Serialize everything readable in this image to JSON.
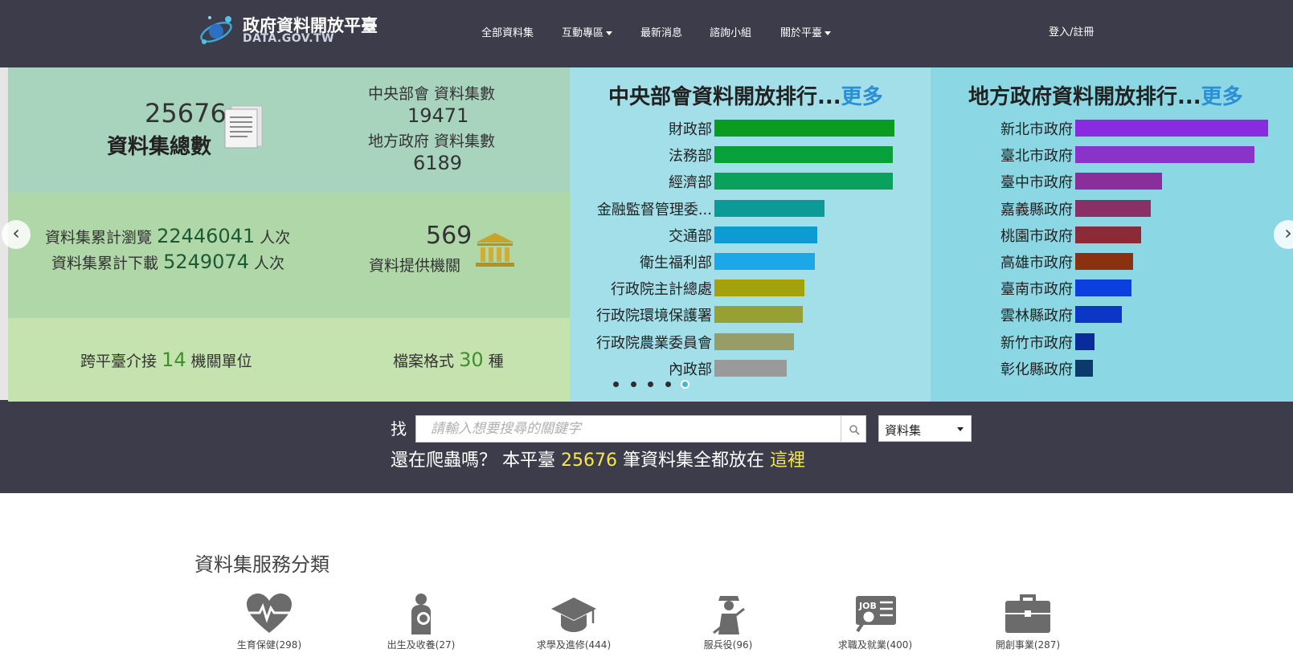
{
  "brand": {
    "title": "政府資料開放平臺",
    "subtitle": "DATA.GOV.TW"
  },
  "nav": {
    "items": [
      "全部資料集",
      "互動專區",
      "最新消息",
      "諮詢小組",
      "關於平臺"
    ]
  },
  "header": {
    "login_label": "登入/註冊"
  },
  "stats": {
    "total_datasets": "25676",
    "total_label": "資料集總數",
    "central_label": "中央部會 資料集數",
    "central_value": "19471",
    "local_label": "地方政府 資料集數",
    "local_value": "6189",
    "views_prefix": "資料集累計瀏覽",
    "views_value": "22446041",
    "views_suffix": "人次",
    "downloads_prefix": "資料集累計下載",
    "downloads_value": "5249074",
    "downloads_suffix": "人次",
    "agencies_value": "569",
    "agencies_label": "資料提供機關",
    "cross_prefix": "跨平臺介接",
    "cross_value": "14",
    "cross_suffix": "機關單位",
    "format_prefix": "檔案格式",
    "format_value": "30",
    "format_suffix": "種"
  },
  "colors": {
    "header_bg": "#3c3c4a",
    "stats_top": "#a8d3bd",
    "stats_mid": "#afd7a8",
    "stats_bottom": "#c5e3ae",
    "chart1_bg": "#a2dfe9",
    "chart2_bg": "#8cd7e4",
    "accent_yellow": "#f7e84a",
    "link_blue": "#2b8fd6"
  },
  "chart_data": [
    {
      "type": "bar",
      "orientation": "horizontal",
      "title": "中央部會資料開放排行...",
      "link": "更多",
      "categories": [
        "財政部",
        "法務部",
        "經濟部",
        "金融監督管理委...",
        "交通部",
        "衛生福利部",
        "行政院主計總處",
        "行政院環境保護署",
        "行政院農業委員會",
        "內政部"
      ],
      "values": [
        1.0,
        0.99,
        0.99,
        0.61,
        0.57,
        0.56,
        0.5,
        0.49,
        0.44,
        0.4
      ],
      "colors": [
        "#0a9b1f",
        "#07a03a",
        "#0aa15c",
        "#0d9a97",
        "#0c9bd3",
        "#1ba7e8",
        "#a4a20c",
        "#96a033",
        "#989c66",
        "#9a9a9a"
      ],
      "grid": false
    },
    {
      "type": "bar",
      "orientation": "horizontal",
      "title": "地方政府資料開放排行...",
      "link": "更多",
      "categories": [
        "新北市政府",
        "臺北市政府",
        "臺中市政府",
        "嘉義縣政府",
        "桃園市政府",
        "高雄市政府",
        "臺南市政府",
        "雲林縣政府",
        "新竹市政府",
        "彰化縣政府"
      ],
      "values": [
        1.0,
        0.93,
        0.45,
        0.39,
        0.34,
        0.3,
        0.29,
        0.24,
        0.1,
        0.09
      ],
      "colors": [
        "#8a2be2",
        "#8a33c8",
        "#8a2e9c",
        "#8c2f66",
        "#8b2b36",
        "#8a3110",
        "#0c3fe0",
        "#0b36c6",
        "#0a2b9a",
        "#0b3a6c"
      ],
      "grid": false
    }
  ],
  "carousel": {
    "dot_count": 5,
    "active_index": 4
  },
  "search": {
    "find_label": "找",
    "placeholder": "請輸入想要搜尋的關鍵字",
    "select_value": "資料集",
    "promo_prefix": "還在爬蟲嗎？ 本平臺",
    "promo_count": "25676",
    "promo_middle": "筆資料集全都放在",
    "promo_link": "這裡"
  },
  "categories": {
    "title": "資料集服務分類",
    "items": [
      {
        "label": "生育保健(298)",
        "icon": "heart-pulse-icon"
      },
      {
        "label": "出生及收養(27)",
        "icon": "parent-baby-icon"
      },
      {
        "label": "求學及進修(444)",
        "icon": "graduation-cap-icon"
      },
      {
        "label": "服兵役(96)",
        "icon": "soldier-icon"
      },
      {
        "label": "求職及就業(400)",
        "icon": "job-search-icon"
      },
      {
        "label": "開創事業(287)",
        "icon": "briefcase-icon"
      }
    ]
  }
}
